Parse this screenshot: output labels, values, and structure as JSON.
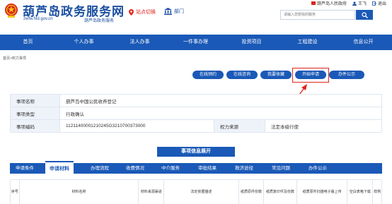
{
  "header": {
    "site_title": "葫芦岛政务服务网",
    "site_url": "zwfw.hld.gov.cn",
    "site_subtitle": "葫芦岛政务服务",
    "location_switch": "站点切换",
    "department": "部门",
    "gov_link": "葫芦岛人民政府",
    "user": "王飞",
    "logout": "退出",
    "search_placeholder": "请输入您想找的服务"
  },
  "nav": {
    "items": [
      "首页",
      "个人办事",
      "法人办事",
      "一件事办理",
      "投资项目",
      "工程建设",
      "信息公开"
    ]
  },
  "breadcrumb": "首页>权力事项",
  "actions": {
    "online_appointment": "在线预约",
    "online_consult": "在线咨询",
    "favorite": "我要收藏",
    "start_apply": "开始申请",
    "public_notice": "办件公示"
  },
  "item_info": {
    "rows": [
      {
        "label": "事项名称",
        "value": "葫芦岛中国公民收养登记"
      },
      {
        "label": "事项类型",
        "value": "行政确认"
      },
      {
        "label": "事项编码",
        "value": "11211400001210245G3210700373000",
        "label2": "权力来源",
        "value2": "法定本级行使"
      }
    ]
  },
  "expand_banner": "事项信息展开",
  "tabs": {
    "items": [
      "申请条件",
      "申请材料",
      "办理流程",
      "收费情况",
      "中介服务",
      "审批结果",
      "救济途径",
      "常见问题",
      "办件公示"
    ],
    "active_index": 1
  },
  "materials_table": {
    "headers": [
      "序号",
      "材料名称",
      "材料来源渠道",
      "法定依据描述",
      "纸质原件份数",
      "纸质复印件及份数",
      "纸质原件扫描电子版上传",
      "空白表格下载",
      "样例"
    ]
  },
  "colors": {
    "primary": "#1a59b7",
    "title": "#1b4fa0",
    "alert": "#e0261b"
  }
}
